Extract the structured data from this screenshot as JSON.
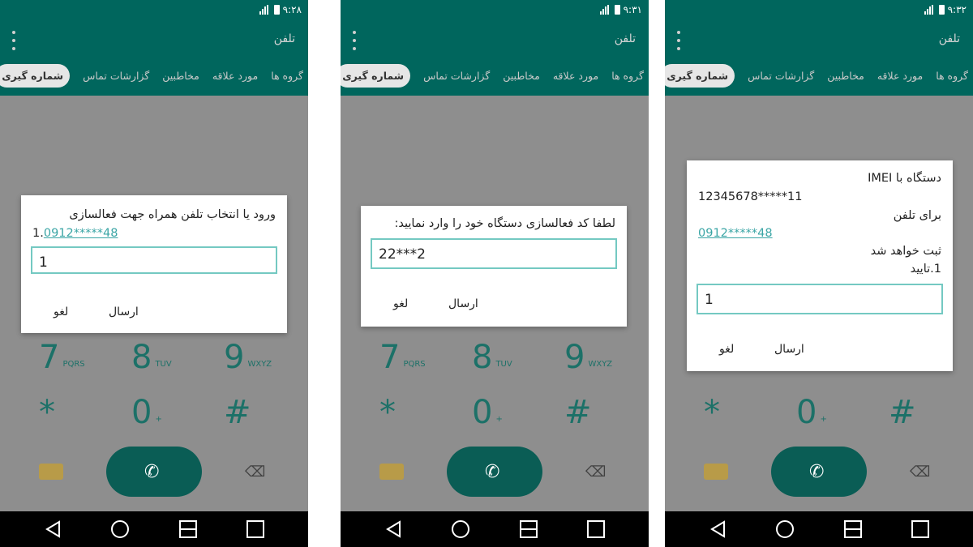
{
  "status": {
    "times": [
      "۹:۲۸",
      "۹:۳۱",
      "۹:۳۲"
    ]
  },
  "app": {
    "title": "تلفن"
  },
  "tabs": [
    "گروه ها",
    "مورد علاقه",
    "مخاطبین",
    "گزارشات تماس",
    "شماره گیری"
  ],
  "keypad": {
    "row1": [
      {
        "d": "7",
        "l": "PQRS"
      },
      {
        "d": "8",
        "l": "TUV"
      },
      {
        "d": "9",
        "l": "WXYZ"
      }
    ],
    "row2": [
      {
        "d": "*",
        "l": ""
      },
      {
        "d": "0",
        "l": "+"
      },
      {
        "d": "#",
        "l": ""
      }
    ]
  },
  "dialogs": [
    {
      "message": "ورود یا انتخاب تلفن همراه جهت فعالسازی",
      "option_prefix": "1.",
      "phone": "0912*****48",
      "input_value": "1",
      "send": "ارسال",
      "cancel": "لغو"
    },
    {
      "message": "لطفا کد فعالسازی دستگاه خود را وارد نمایید:",
      "input_value": "22***2",
      "send": "ارسال",
      "cancel": "لغو"
    },
    {
      "line1": "دستگاه با IMEI",
      "imei": "12345678*****11",
      "line3": "برای تلفن",
      "phone": "0912*****48",
      "line5": "ثبت خواهد شد",
      "confirm": "1.تایید",
      "input_value": "1",
      "send": "ارسال",
      "cancel": "لغو"
    }
  ],
  "colors": {
    "primary": "#00665d",
    "accent": "#74c9c2",
    "link": "#3aa5a5"
  }
}
